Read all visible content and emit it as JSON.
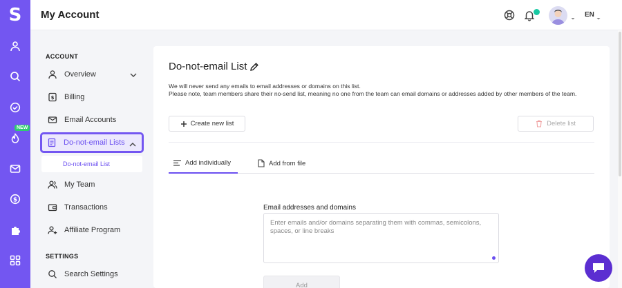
{
  "brand": {
    "logo": "S"
  },
  "rail": {
    "icons": [
      "user-icon",
      "search-icon",
      "check-circle-icon",
      "flame-icon",
      "mail-icon",
      "dollar-icon",
      "puzzle-icon",
      "apps-grid-icon"
    ],
    "new_badge": "NEW"
  },
  "header": {
    "title": "My Account",
    "language": "EN",
    "notification_dot_color": "#18c9a3"
  },
  "sidebar": {
    "account_heading": "ACCOUNT",
    "settings_heading": "SETTINGS",
    "items": [
      {
        "label": "Overview",
        "icon": "user-icon"
      },
      {
        "label": "Billing",
        "icon": "dollar-icon"
      },
      {
        "label": "Email Accounts",
        "icon": "mail-icon"
      },
      {
        "label": "Do-not-email Lists",
        "icon": "document-icon"
      },
      {
        "label": "My Team",
        "icon": "team-icon"
      },
      {
        "label": "Transactions",
        "icon": "wallet-icon"
      },
      {
        "label": "Affiliate Program",
        "icon": "user-plus-icon"
      },
      {
        "label": "Search Settings",
        "icon": "search-icon"
      }
    ],
    "sub_item": "Do-not-email List"
  },
  "main": {
    "title": "Do-not-email List",
    "description_line1": "We will never send any emails to email addresses or domains on this list.",
    "description_line2": "Please note, team members share their no-send list, meaning no one from the team can email domains or addresses added by other members of the team.",
    "create_button": "Create new list",
    "delete_button": "Delete list",
    "tabs": [
      {
        "label": "Add individually",
        "active": true
      },
      {
        "label": "Add from file",
        "active": false
      }
    ],
    "field_label": "Email addresses and domains",
    "field_placeholder": "Enter emails and/or domains separating them with commas, semicolons, spaces, or line breaks",
    "add_button": "Add"
  },
  "colors": {
    "accent": "#7356f1",
    "accent_text": "#6a4ef0",
    "chat_bubble": "#5b2ed1"
  }
}
